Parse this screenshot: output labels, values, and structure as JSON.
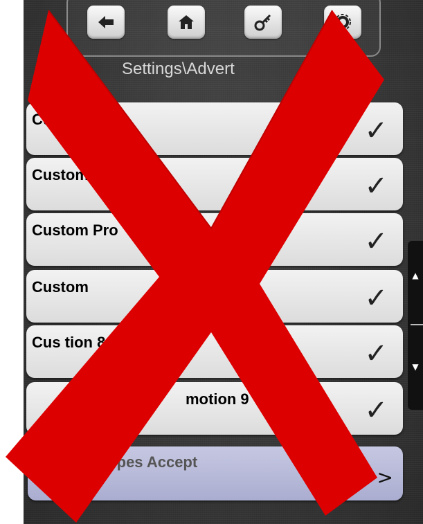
{
  "toolbar": {
    "buttons": [
      {
        "name": "back-button",
        "icon": "back-arrow-icon"
      },
      {
        "name": "home-button",
        "icon": "home-icon"
      },
      {
        "name": "key-button",
        "icon": "key-icon"
      },
      {
        "name": "settings-button",
        "icon": "gear-icon"
      }
    ]
  },
  "breadcrumb": "Settings\\Advert",
  "list": {
    "rows": [
      {
        "label": "Cu          tion",
        "checked": true,
        "mark": "✓"
      },
      {
        "label": "Custom",
        "checked": true,
        "mark": "✓"
      },
      {
        "label": "Custom Pro",
        "checked": true,
        "mark": "✓"
      },
      {
        "label": "Custom",
        "checked": true,
        "mark": "✓"
      },
      {
        "label": "Cus             tion 8",
        "checked": true,
        "mark": "✓"
      },
      {
        "label": "motion 9",
        "checked": true,
        "mark": "✓"
      }
    ],
    "credit_card_row": {
      "label": "Cred     ard Types Accept",
      "arrow": ">"
    }
  },
  "scroll": {
    "up": "▲",
    "down": "▼"
  },
  "overlay": {
    "type": "red-x-mark",
    "color": "#dd0000"
  }
}
